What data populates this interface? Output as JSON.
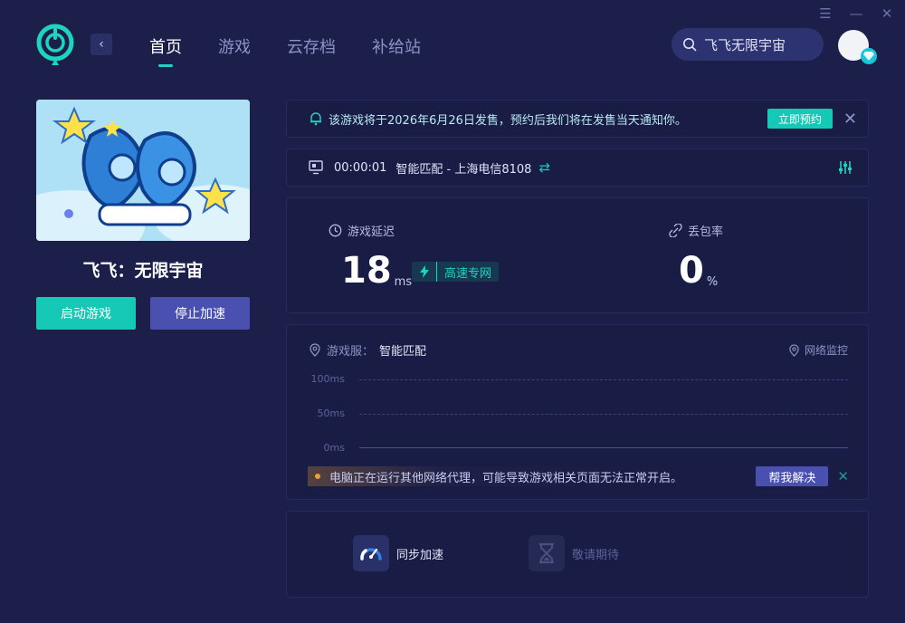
{
  "window_controls": {
    "menu": "☰",
    "minimize": "—",
    "close": "✕"
  },
  "header": {
    "back_glyph": "‹",
    "nav": [
      "首页",
      "游戏",
      "云存档",
      "补给站"
    ],
    "active_nav": 0,
    "search_text": "飞飞无限宇宙"
  },
  "game": {
    "title": "飞飞：无限宇宙",
    "start_label": "启动游戏",
    "stop_label": "停止加速"
  },
  "notice": {
    "text": "该游戏将于2026年6月26日发售，预约后我们将在发售当天通知你。",
    "button_label": "立即预约",
    "close": "✕"
  },
  "status": {
    "timer": "00:00:01",
    "route": "智能匹配 - 上海电信8108",
    "swap_glyph": "⇄"
  },
  "metrics": {
    "latency_label": "游戏延迟",
    "latency_value": "18",
    "latency_unit": "ms",
    "tag_label": "高速专网",
    "loss_label": "丢包率",
    "loss_value": "0",
    "loss_unit": "%"
  },
  "monitor": {
    "server_label": "游戏服：",
    "server_value": "智能匹配",
    "link_label": "网络监控",
    "ticks": [
      "100ms",
      "50ms",
      "0ms"
    ]
  },
  "warning": {
    "text": "电脑正在运行其他网络代理，可能导致游戏相关页面无法正常开启。",
    "button_label": "帮我解决",
    "close": "✕"
  },
  "tools": [
    {
      "label": "同步加速",
      "enabled": true
    },
    {
      "label": "敬请期待",
      "enabled": false
    }
  ],
  "colors": {
    "background": "#1b1f4a",
    "accent": "#16c9b6",
    "secondary_button": "#4a50b0",
    "warning": "#f0a030"
  }
}
